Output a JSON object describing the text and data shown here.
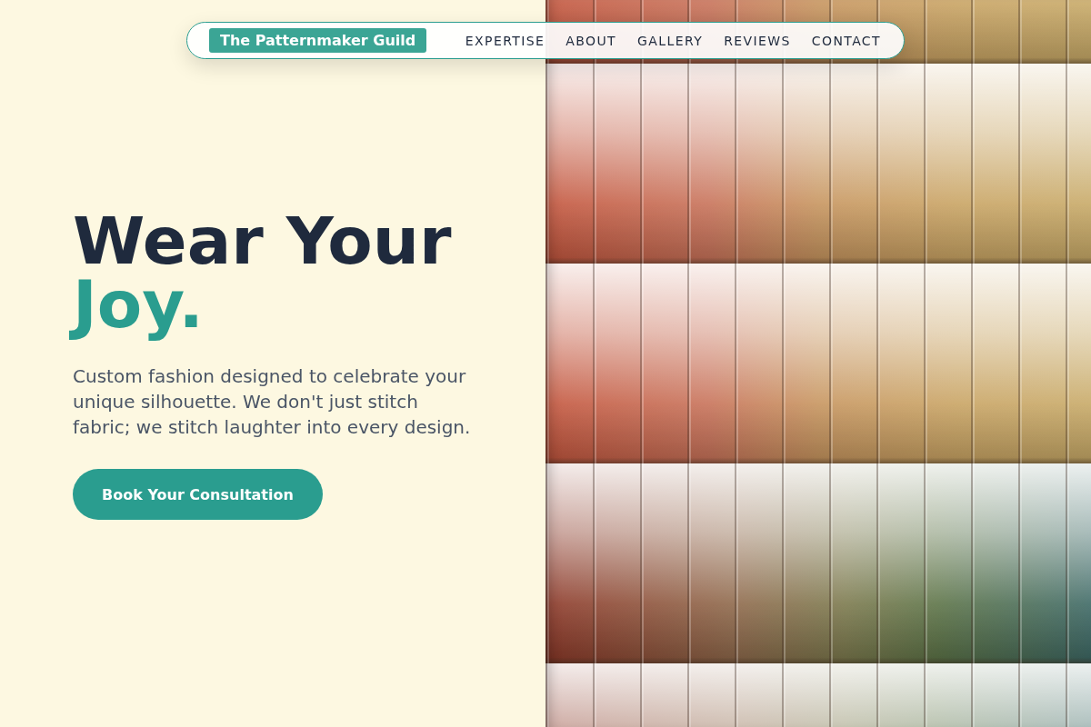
{
  "nav": {
    "brand": "The Patternmaker Guild",
    "links": [
      "EXPERTISE",
      "ABOUT",
      "GALLERY",
      "REVIEWS",
      "CONTACT"
    ]
  },
  "hero": {
    "headline": "Wear Your",
    "headline_accent": "Joy.",
    "description": "Custom fashion designed to celebrate your unique silhouette. We don't just stitch fabric; we stitch laughter into every design.",
    "cta": "Book Your Consultation"
  }
}
